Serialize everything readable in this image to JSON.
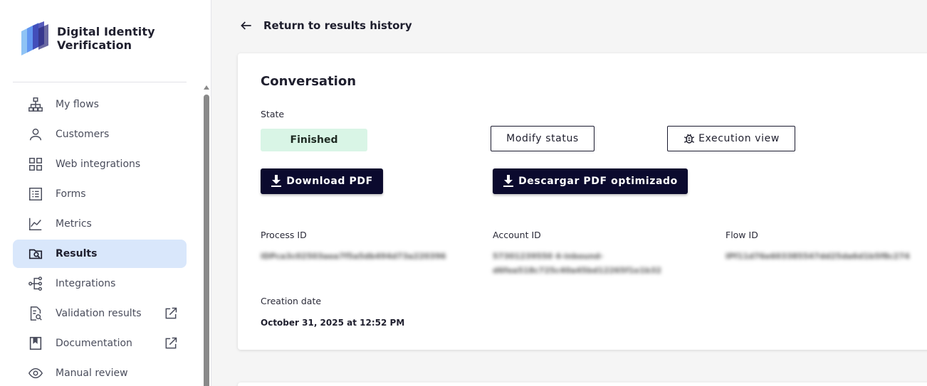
{
  "brand": {
    "line1": "Digital Identity",
    "line2": "Verification"
  },
  "sidebar": {
    "items": [
      {
        "label": "My flows",
        "icon": "flow-tree-icon"
      },
      {
        "label": "Customers",
        "icon": "person-icon"
      },
      {
        "label": "Web integrations",
        "icon": "grid-icon"
      },
      {
        "label": "Forms",
        "icon": "list-form-icon"
      },
      {
        "label": "Metrics",
        "icon": "chart-line-icon"
      },
      {
        "label": "Results",
        "icon": "folder-search-icon",
        "active": true
      },
      {
        "label": "Integrations",
        "icon": "integrations-icon"
      },
      {
        "label": "Validation results",
        "icon": "document-search-icon",
        "external": true
      },
      {
        "label": "Documentation",
        "icon": "book-icon",
        "external": true
      },
      {
        "label": "Manual review",
        "icon": "eye-icon"
      }
    ]
  },
  "header": {
    "back_label": "Return to results history"
  },
  "conversation": {
    "title": "Conversation",
    "state_label": "State",
    "state_value": "Finished",
    "modify_status_label": "Modify status",
    "execution_view_label": "Execution view",
    "download_pdf_label": "Download PDF",
    "download_optimized_label": "Descargar PDF optimizado",
    "process_id_label": "Process ID",
    "process_id_value": "IDPca3c02503aea7f5a5db494d73a220396",
    "account_id_label": "Account ID",
    "account_id_value_line1": "57301239550 4-inbound-",
    "account_id_value_line2": "d6fea518c725c40a45bd12265f1e1b32",
    "flow_id_label": "Flow ID",
    "flow_id_value": "IPf11d76e603385547dd25da6d1b5f8c274",
    "creation_date_label": "Creation date",
    "creation_date_value": "October 31, 2025 at 12:52 PM"
  },
  "colors": {
    "accent_dark": "#0b0a2e",
    "active_nav_bg": "#d9e7fb",
    "state_bg": "#d9f5e6"
  }
}
